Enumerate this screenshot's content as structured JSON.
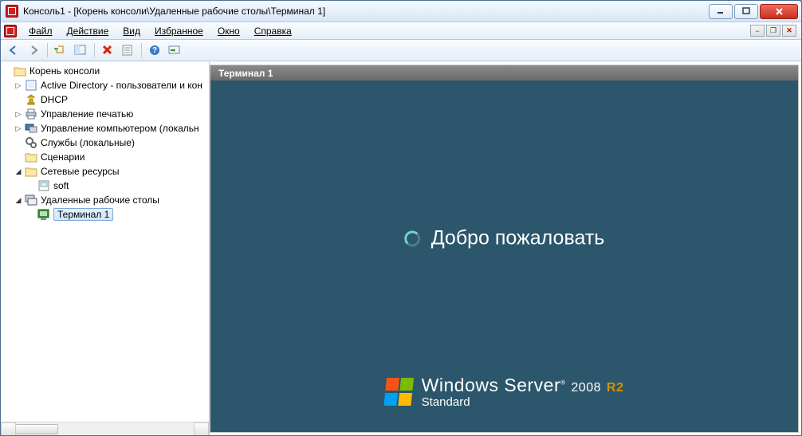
{
  "window": {
    "title": "Консоль1 - [Корень консоли\\Удаленные рабочие столы\\Терминал 1]"
  },
  "menu": {
    "file": "Файл",
    "action": "Действие",
    "view": "Вид",
    "favorites": "Избранное",
    "window": "Окно",
    "help": "Справка"
  },
  "tree": {
    "root": "Корень консоли",
    "ad": "Active Directory - пользователи и кон",
    "dhcp": "DHCP",
    "print": "Управление печатью",
    "compmgmt": "Управление компьютером (локальн",
    "services": "Службы (локальные)",
    "scenarios": "Сценарии",
    "net": "Сетевые ресурсы",
    "soft": "soft",
    "rdp": "Удаленные рабочие столы",
    "term1": "Терминал 1"
  },
  "pane": {
    "header": "Терминал 1",
    "welcome": "Добро пожаловать",
    "brand1": "Windows Server",
    "brandYear": "2008",
    "brandR2": "R2",
    "brand2": "Standard"
  }
}
